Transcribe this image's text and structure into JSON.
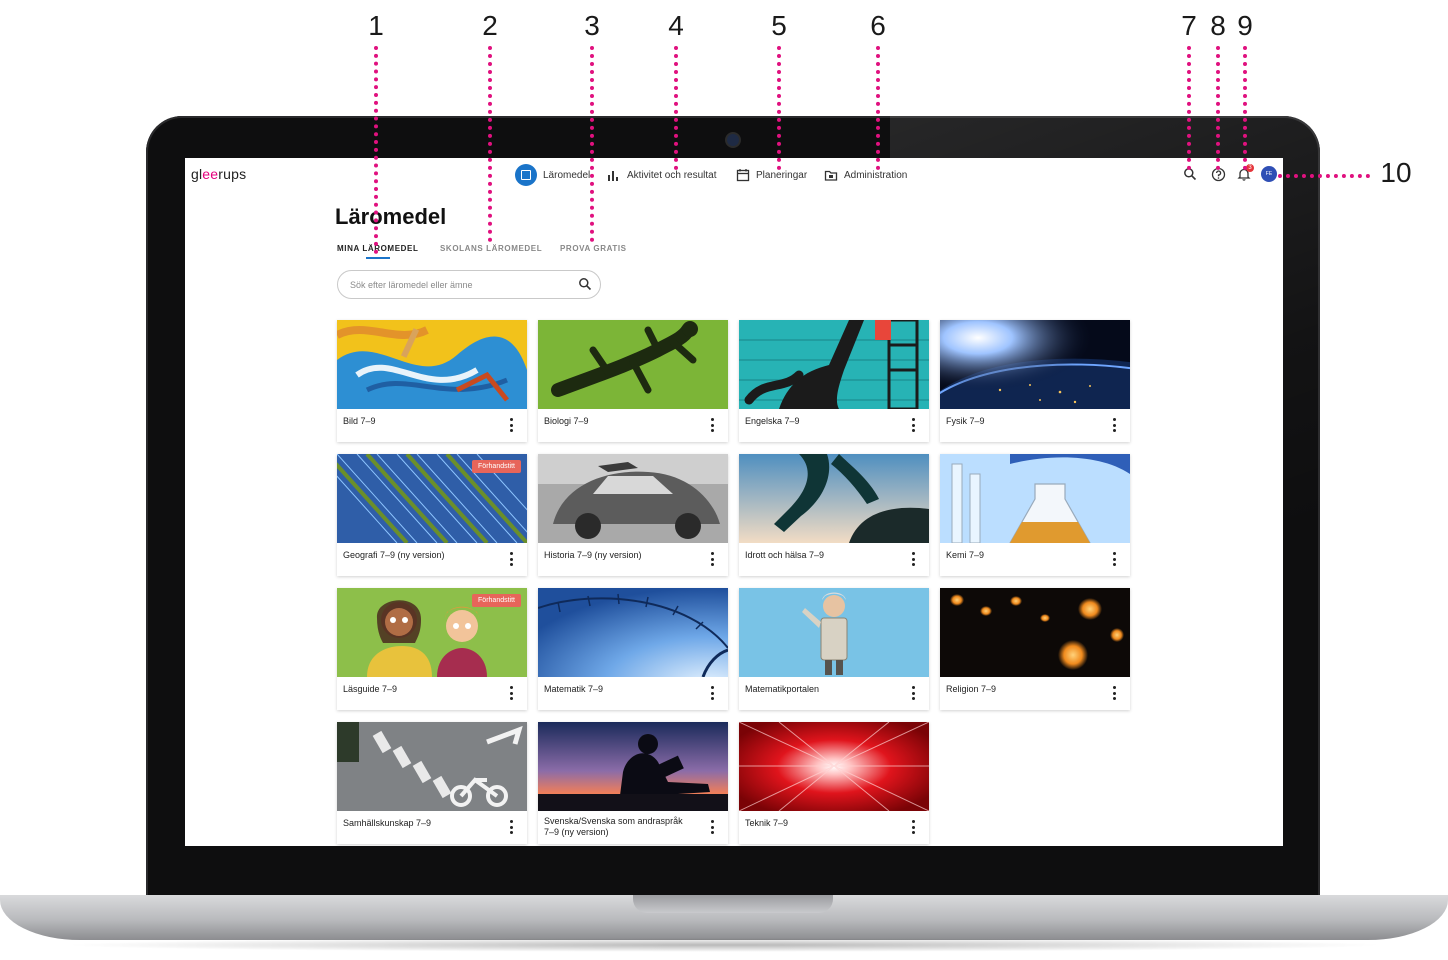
{
  "callouts": [
    "1",
    "2",
    "3",
    "4",
    "5",
    "6",
    "7",
    "8",
    "9",
    "10"
  ],
  "app": {
    "logo": {
      "prefix": "gl",
      "accent": "ee",
      "suffix": "rups"
    },
    "nav": {
      "laromedel": "Läromedel",
      "aktivitet": "Aktivitet och resultat",
      "planeringar": "Planeringar",
      "administration": "Administration"
    },
    "utilities": {
      "search_icon": "search-icon",
      "help_icon": "help-icon",
      "notifications_icon": "bell-icon",
      "notification_count": "3",
      "avatar_initials": "FE"
    },
    "colors": {
      "accent": "#1a74c9",
      "brand": "#e5007e",
      "callout": "#e0117f",
      "preview_tag": "#e7655a"
    }
  },
  "page": {
    "title": "Läromedel",
    "tabs": [
      "MINA LÄROMEDEL",
      "SKOLANS LÄROMEDEL",
      "PROVA GRATIS"
    ],
    "active_tab": "MINA LÄROMEDEL",
    "search_placeholder": "Sök efter läromedel eller ämne"
  },
  "cards": [
    {
      "title": "Bild 7–9",
      "tag": ""
    },
    {
      "title": "Biologi 7–9",
      "tag": ""
    },
    {
      "title": "Engelska 7–9",
      "tag": ""
    },
    {
      "title": "Fysik 7–9",
      "tag": ""
    },
    {
      "title": "Geografi 7–9 (ny version)",
      "tag": "Förhandstitt"
    },
    {
      "title": "Historia 7–9 (ny version)",
      "tag": ""
    },
    {
      "title": "Idrott och hälsa 7–9",
      "tag": ""
    },
    {
      "title": "Kemi 7–9",
      "tag": ""
    },
    {
      "title": "Läsguide 7–9",
      "tag": "Förhandstitt"
    },
    {
      "title": "Matematik 7–9",
      "tag": ""
    },
    {
      "title": "Matematikportalen",
      "tag": ""
    },
    {
      "title": "Religion 7–9",
      "tag": ""
    },
    {
      "title": "Samhällskunskap 7–9",
      "tag": ""
    },
    {
      "title": "Svenska/Svenska som andraspråk 7–9 (ny version)",
      "tag": ""
    },
    {
      "title": "Teknik 7–9",
      "tag": ""
    }
  ]
}
